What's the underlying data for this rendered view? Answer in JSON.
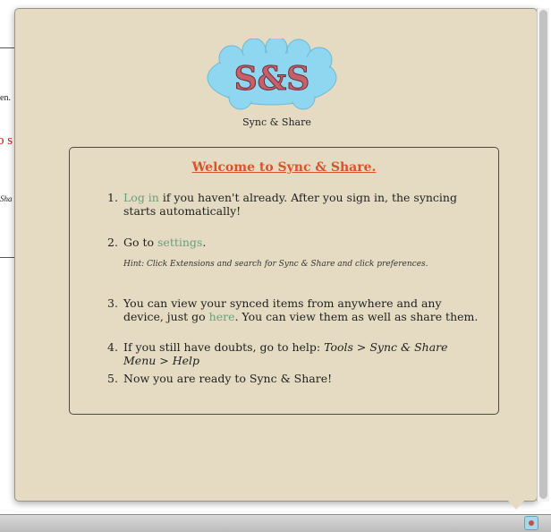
{
  "background_page": {
    "fragment_1": "en.",
    "fragment_2": "o s",
    "fragment_3": "Sha"
  },
  "logo": {
    "text": "S&S",
    "caption": "Sync & Share"
  },
  "welcome": {
    "title": "Welcome to Sync & Share.",
    "step1": {
      "number": "1.",
      "link": "Log in",
      "text": " if you haven't already. After you sign in, the syncing starts automatically!"
    },
    "step2": {
      "number": "2.",
      "prefix": "Go to ",
      "link": "settings",
      "suffix": "."
    },
    "hint": "Hint: Click Extensions and search for Sync & Share and click preferences.",
    "step3": {
      "number": "3.",
      "prefix": "You can view your synced items from anywhere and any device, just go ",
      "link": "here",
      "suffix": ". You can view them as well as share them."
    },
    "step4": {
      "number": "4.",
      "prefix": "If you still have doubts, go to help: ",
      "path": "Tools > Sync & Share Menu > Help"
    },
    "step5": {
      "number": "5.",
      "text": "Now you are ready to Sync & Share!"
    }
  },
  "colors": {
    "panel": "#e4dbc2",
    "title": "#d9532b",
    "link": "#6aa079",
    "cloud": "#8fd6f0"
  }
}
